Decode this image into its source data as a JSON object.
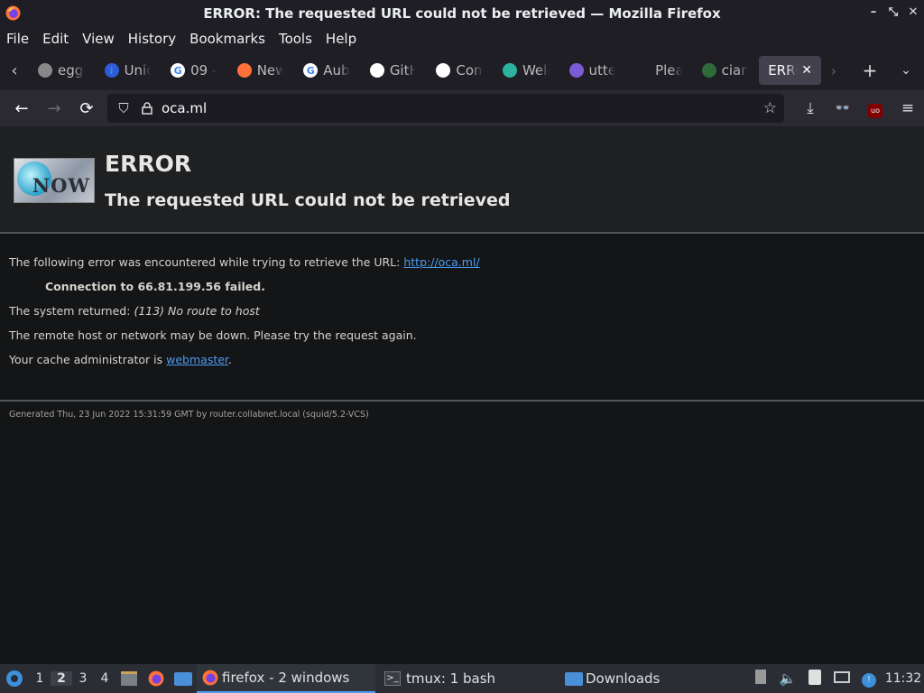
{
  "window": {
    "title": "ERROR: The requested URL could not be retrieved — Mozilla Firefox",
    "controls": [
      "–",
      "⤡",
      "✕"
    ]
  },
  "menu": [
    "File",
    "Edit",
    "View",
    "History",
    "Bookmarks",
    "Tools",
    "Help"
  ],
  "tabs": [
    {
      "label": "eggy",
      "icon_color": "#888"
    },
    {
      "label": "Unic",
      "icon_color": "#2c5cd6",
      "icon_char": "i"
    },
    {
      "label": "09 -",
      "icon_color": "#ffffff",
      "icon_char": "G"
    },
    {
      "label": "New",
      "icon_color": "#ff7139"
    },
    {
      "label": "Aub",
      "icon_color": "#ffffff",
      "icon_char": "G"
    },
    {
      "label": "GitH",
      "icon_color": "#ffffff"
    },
    {
      "label": "Com",
      "icon_color": "#ffffff"
    },
    {
      "label": "Welc",
      "icon_color": "#2bb3a0"
    },
    {
      "label": "utte",
      "icon_color": "#7c5cd6"
    },
    {
      "label": "Plea",
      "icon_color": "transparent"
    },
    {
      "label": "cian",
      "icon_color": "#2f6b3a"
    },
    {
      "label": "ERRO",
      "active": true
    }
  ],
  "url": "oca.ml",
  "page": {
    "title": "ERROR",
    "subtitle": "The requested URL could not be retrieved",
    "logo_text": "NOW",
    "line1_prefix": "The following error was encountered while trying to retrieve the URL:",
    "line1_link": "http://oca.ml/",
    "failed": "Connection to 66.81.199.56 failed.",
    "returned_prefix": "The system returned:",
    "returned_value": "(113) No route to host",
    "remote": "The remote host or network may be down. Please try the request again.",
    "admin_prefix": "Your cache administrator is",
    "admin_link": "webmaster",
    "admin_suffix": ".",
    "footer": "Generated Thu, 23 Jun 2022 15:31:59 GMT by router.collabnet.local (squid/5.2-VCS)"
  },
  "taskbar": {
    "workspaces": [
      "1",
      "2",
      "3",
      "4"
    ],
    "active_workspace": "2",
    "tasks": [
      "firefox - 2 windows",
      "tmux: 1 bash",
      "Downloads"
    ],
    "clock": "11:32"
  }
}
